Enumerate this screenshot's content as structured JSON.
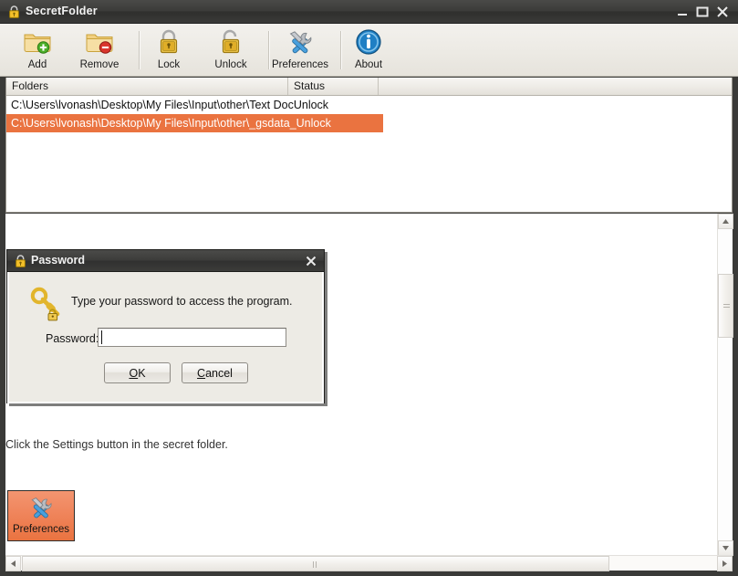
{
  "window": {
    "title": "SecretFolder",
    "title_icon": "lock-icon",
    "controls": {
      "minimize": "minimize-icon",
      "maximize": "maximize-icon",
      "close": "close-icon"
    }
  },
  "toolbar": {
    "items": [
      {
        "label": "Add",
        "icon": "folder-add-icon"
      },
      {
        "label": "Remove",
        "icon": "folder-remove-icon"
      },
      {
        "label": "Lock",
        "icon": "padlock-closed-icon"
      },
      {
        "label": "Unlock",
        "icon": "padlock-open-icon"
      },
      {
        "label": "Preferences",
        "icon": "tools-icon"
      },
      {
        "label": "About",
        "icon": "info-icon"
      }
    ]
  },
  "list": {
    "columns": [
      "Folders",
      "Status",
      ""
    ],
    "rows": [
      {
        "folder": "C:\\Users\\lvonash\\Desktop\\My Files\\Input\\other\\Text DocUnlock",
        "status": "",
        "selected": false
      },
      {
        "folder": "C:\\Users\\lvonash\\Desktop\\My Files\\Input\\other\\_gsdata_Unlock",
        "status": "",
        "selected": true
      }
    ]
  },
  "annotation": {
    "hint": "Click the Settings button in the secret folder.",
    "highlight_button": {
      "label": "Preferences",
      "icon": "tools-icon"
    }
  },
  "dialog": {
    "title": "Password",
    "title_icon": "lock-icon",
    "close_icon": "close-icon",
    "icon": "key-lock-icon",
    "message": "Type your password to access the program.",
    "field_label": "Password:",
    "field_value": "",
    "field_placeholder": "",
    "ok_label": "OK",
    "ok_mnemonic": "O",
    "cancel_label": "Cancel",
    "cancel_mnemonic": "C"
  },
  "scrollbars": {
    "vertical": {
      "up_icon": "caret-up-icon",
      "down_icon": "caret-down-icon"
    },
    "horizontal": {
      "left_icon": "caret-left-icon",
      "right_icon": "caret-right-icon"
    }
  },
  "colors": {
    "selection_orange": "#ea7340",
    "highlight_orange": "#ef8359",
    "titlebar_dark": "#3a3a38",
    "toolbar_beige": "#eceae4"
  }
}
